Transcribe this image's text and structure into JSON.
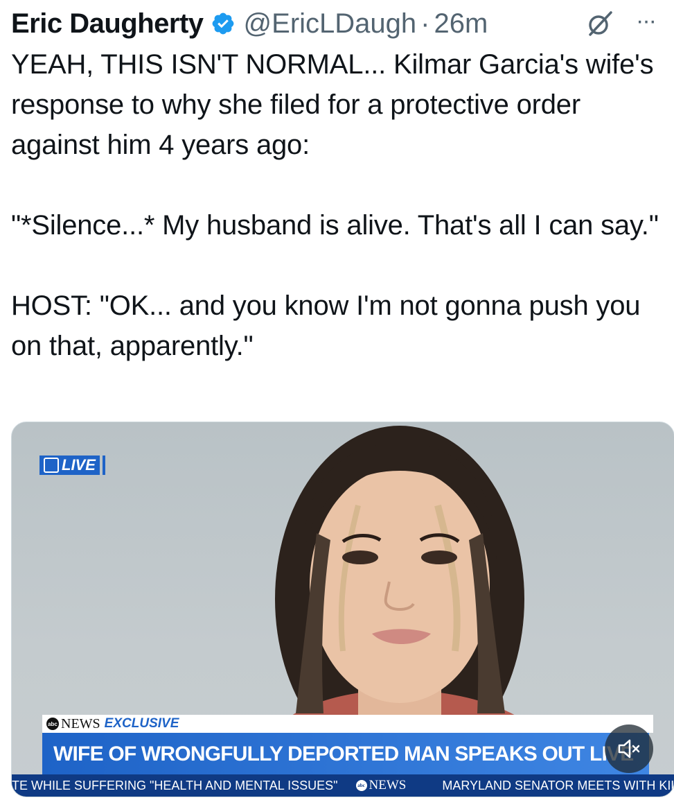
{
  "author": {
    "name": "Eric Daugherty",
    "handle": "@EricLDaugh",
    "separator": "·",
    "time": "26m",
    "verified": true,
    "badge_color": "#1d9bf0"
  },
  "actions": {
    "grok_icon": "grok-icon",
    "more_icon": "more-icon",
    "more_label": "···"
  },
  "tweet": {
    "text": "YEAH, THIS ISN'T NORMAL... Kilmar Garcia's wife's response to why she filed for a protective order against him 4 years ago:\n\n\"*Silence...* My husband is alive. That's all I can say.\"\n\nHOST: \"OK... and you know I'm not gonna push you on that, apparently.\""
  },
  "video": {
    "live_label": "LIVE",
    "exclusive_news": "NEWS",
    "exclusive_label": "EXCLUSIVE",
    "abc_label": "abc",
    "headline": "WIFE OF WRONGFULLY DEPORTED MAN SPEAKS OUT LIVE",
    "ticker": {
      "left": "TE WHILE SUFFERING \"HEALTH AND MENTAL ISSUES\"",
      "news": "NEWS",
      "right": "MARYLAND SENATOR MEETS WITH KIL"
    },
    "mute_icon": "muted-speaker-icon",
    "accent": "#1e63c7",
    "ticker_bg": "#0f3a84"
  }
}
